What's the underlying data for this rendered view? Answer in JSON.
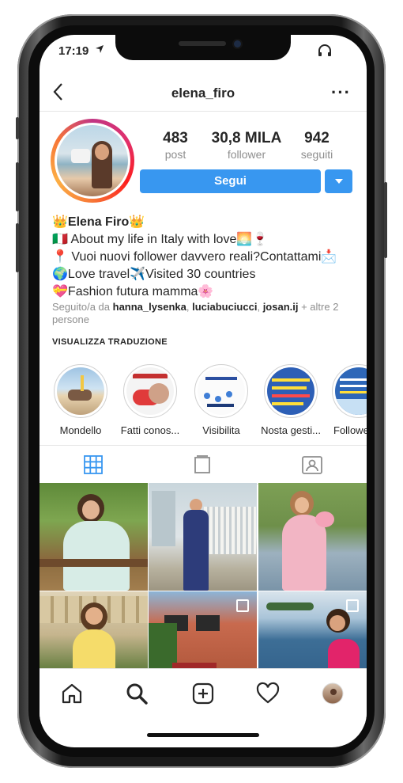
{
  "status": {
    "time": "17:19",
    "location_icon": "location-arrow-icon",
    "headphones_icon": "headphones-icon"
  },
  "header": {
    "username": "elena_firo",
    "back_icon": "chevron-left-icon",
    "more_icon": "more-dots-icon",
    "more_label": "···"
  },
  "stats": [
    {
      "value": "483",
      "label": "post"
    },
    {
      "value": "30,8 MILA",
      "label": "follower"
    },
    {
      "value": "942",
      "label": "seguiti"
    }
  ],
  "actions": {
    "follow_label": "Segui",
    "dropdown_icon": "caret-down-icon"
  },
  "bio": {
    "name": "👑Elena Firo👑",
    "lines": [
      "🇮🇹 About my life in Italy with love🌅🍷",
      "📍 Vuoi nuovi follower davvero reali?Contattami📩",
      "🌍Love travel✈️Visited 30 countries",
      "💝Fashion futura mamma🌸"
    ]
  },
  "followed_by": {
    "prefix": "Seguito/a da ",
    "names": [
      "hanna_lysenka",
      "luciabuciucci",
      "josan.ij"
    ],
    "sep": ", ",
    "suffix": " + altre 2 persone"
  },
  "translate_label": "VISUALIZZA TRADUZIONE",
  "highlights": [
    {
      "label": "Mondello"
    },
    {
      "label": "Fatti conos..."
    },
    {
      "label": "Visibilita"
    },
    {
      "label": "Nosta gesti..."
    },
    {
      "label": "Followe"
    }
  ],
  "tabs": [
    {
      "name": "grid",
      "icon": "grid-icon",
      "active": true
    },
    {
      "name": "igtv",
      "icon": "igtv-icon",
      "active": false
    },
    {
      "name": "tagged",
      "icon": "tagged-person-icon",
      "active": false
    }
  ],
  "bottom_nav": [
    {
      "name": "home",
      "icon": "home-icon"
    },
    {
      "name": "search",
      "icon": "search-icon"
    },
    {
      "name": "new-post",
      "icon": "plus-square-icon"
    },
    {
      "name": "activity",
      "icon": "heart-icon"
    },
    {
      "name": "profile",
      "icon": "profile-avatar-icon"
    }
  ],
  "colors": {
    "accent": "#3897f0",
    "text": "#262626",
    "muted": "#8e8e8e",
    "border": "#e6e6e6"
  }
}
